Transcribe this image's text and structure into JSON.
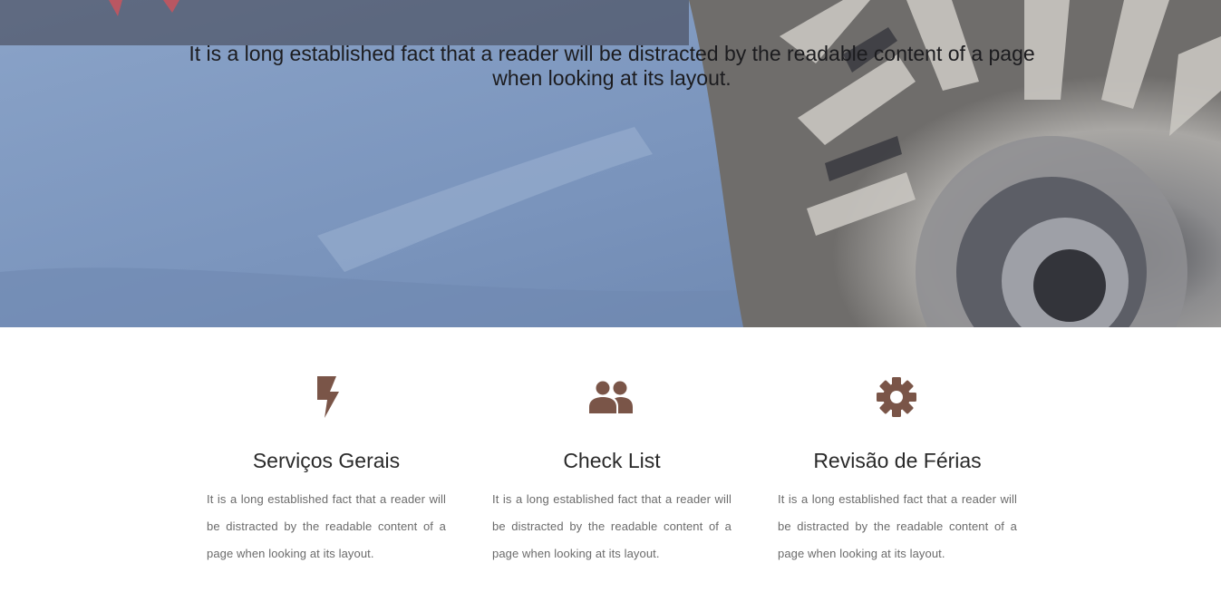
{
  "hero": {
    "text": "It is a long established fact that a reader will be distracted by the readable content of a page when looking at its layout."
  },
  "features": [
    {
      "icon": "lightning-bolt-icon",
      "title": "Serviços Gerais",
      "description": "It is a long established fact that a reader will be distracted by the readable content of a page when looking at its layout."
    },
    {
      "icon": "people-group-icon",
      "title": "Check List",
      "description": "It is a long established fact that a reader will be distracted by the readable content of a page when looking at its layout."
    },
    {
      "icon": "gear-icon",
      "title": "Revisão de Férias",
      "description": "It is a long established fact that a reader will be distracted by the readable content of a page when looking at its layout."
    }
  ],
  "colors": {
    "icon": "#7a5548",
    "title": "#2a2a2a",
    "text": "#6b6b6b"
  }
}
